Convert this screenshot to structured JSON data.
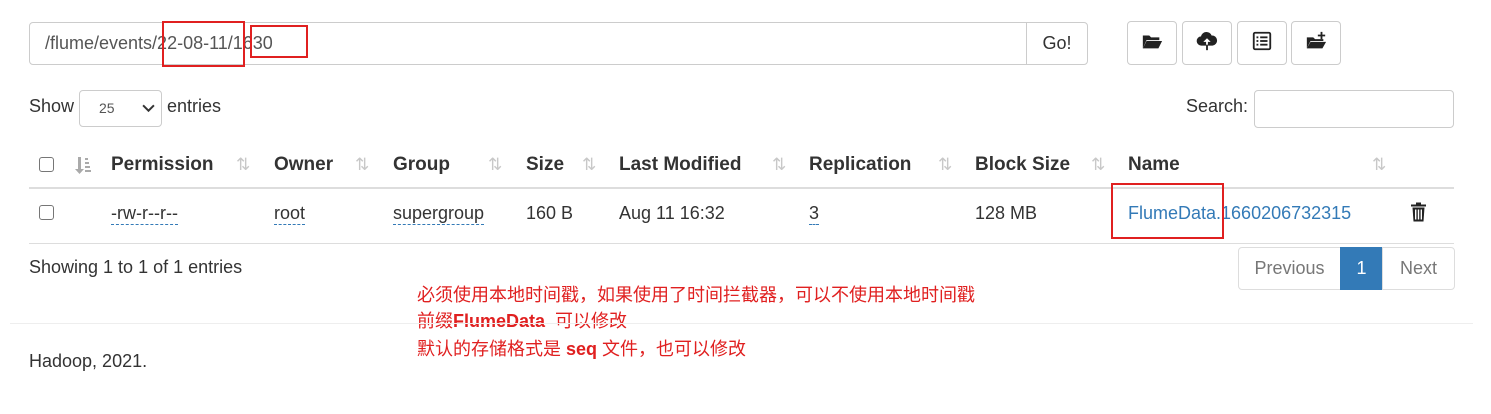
{
  "path_bar": {
    "value": "/flume/events/22-08-11/1630",
    "go_label": "Go!"
  },
  "toolbar": {
    "icons": [
      "folder-open-icon",
      "cloud-upload-icon",
      "list-alt-icon",
      "create-folder-icon"
    ]
  },
  "length_menu": {
    "show_label": "Show",
    "selected": "25",
    "entries_label": "entries"
  },
  "search": {
    "label": "Search:",
    "value": ""
  },
  "table": {
    "columns": [
      "Permission",
      "Owner",
      "Group",
      "Size",
      "Last Modified",
      "Replication",
      "Block Size",
      "Name"
    ],
    "rows": [
      {
        "permission": "-rw-r--r--",
        "owner": "root",
        "group": "supergroup",
        "size": "160 B",
        "last_modified": "Aug 11 16:32",
        "replication": "3",
        "block_size": "128 MB",
        "name": "FlumeData.1660206732315"
      }
    ]
  },
  "info": "Showing 1 to 1 of 1 entries",
  "pagination": {
    "previous": "Previous",
    "current": "1",
    "next": "Next"
  },
  "footer": "Hadoop, 2021.",
  "annotation": {
    "line1": "必须使用本地时间戳，如果使用了时间拦截器，可以不使用本地时间戳",
    "line2_prefix": "前缀",
    "line2_bold": "FlumeData",
    "line2_suffix": "  可以修改",
    "line3_prefix": "默认的存储格式是 ",
    "line3_bold": "seq",
    "line3_suffix": " 文件，也可以修改",
    "color": "#e02020"
  },
  "colors": {
    "link": "#337ab7",
    "active_page": "#337ab7",
    "highlight_box": "#e02020"
  }
}
